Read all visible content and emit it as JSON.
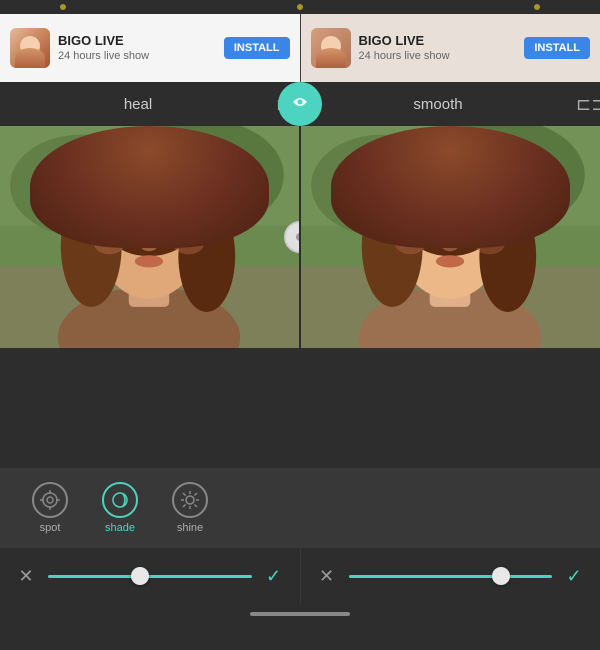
{
  "dots": {
    "count": 3
  },
  "ads": {
    "left": {
      "title": "BIGO LIVE",
      "subtitle": "24 hours live show",
      "install_label": "INSTALL"
    },
    "right": {
      "title": "BIGO LIVE",
      "subtitle": "24 hours live show",
      "install_label": "INSTALL"
    }
  },
  "filters": {
    "left_label": "heal",
    "right_label": "smooth",
    "swap_icon": "⇄"
  },
  "tools": [
    {
      "id": "spot",
      "label": "spot",
      "icon": "◎",
      "active": false
    },
    {
      "id": "shade",
      "label": "shade",
      "active": true
    },
    {
      "id": "shine",
      "label": "shine",
      "active": false
    }
  ],
  "controls": {
    "left": {
      "cancel_icon": "✕",
      "confirm_icon": "✓",
      "slider_position": 0.45
    },
    "right": {
      "cancel_icon": "✕",
      "confirm_icon": "✓",
      "slider_position": 0.75
    }
  },
  "colors": {
    "accent": "#4dd4c0",
    "dark_bg": "#2d2d2d",
    "panel_bg": "#383838",
    "text_muted": "#aaaaaa"
  }
}
